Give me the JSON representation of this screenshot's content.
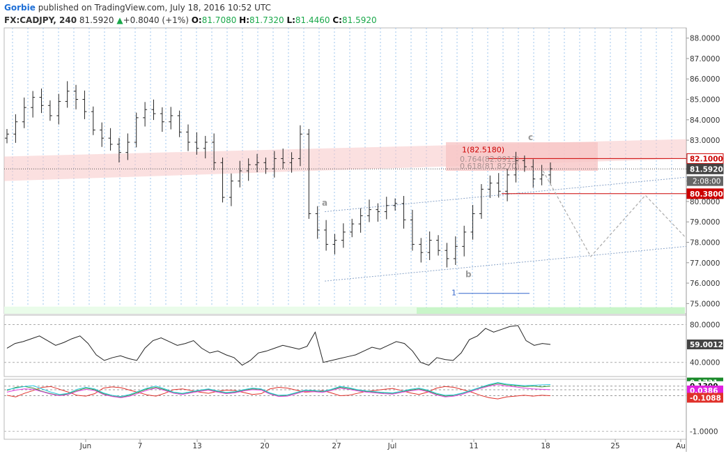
{
  "header": {
    "author": "Gorbie",
    "published_text": "published on TradingView.com, July 18, 2016 10:52 UTC"
  },
  "symbol": {
    "ticker": "FX:CADJPY, 240",
    "last": "81.5920",
    "change": "+0.8040 (+1%)",
    "open_label": "O:",
    "open": "81.7080",
    "high_label": "H:",
    "high": "81.7320",
    "low_label": "L:",
    "low": "81.4460",
    "close_label": "C:",
    "close": "81.5920"
  },
  "colors": {
    "up": "#1aa84a",
    "price_line": "#222222",
    "resistance_zone": "#f7c6c6",
    "support_zone": "#c9f5c9",
    "level_red": "#cc0000",
    "fib_blue": "#3366cc",
    "gridline_blue": "#9ec5ee",
    "oscillator_red": "#e0302a",
    "oscillator_green": "#3a9a3a",
    "oscillator_cyan": "#29c6e0",
    "oscillator_magenta": "#e040e0"
  },
  "chart_data": [
    {
      "type": "candlestick",
      "title": "",
      "x_tick_labels": [
        "Jun",
        "7",
        "13",
        "20",
        "27",
        "Jul",
        "11",
        "18",
        "25",
        "Au"
      ],
      "ylim": [
        74.5,
        88.5
      ],
      "y_tick_labels": [
        "88.0000",
        "87.0000",
        "86.0000",
        "85.0000",
        "84.0000",
        "83.0000",
        "82.0000",
        "81.0000",
        "80.0000",
        "79.0000",
        "78.0000",
        "77.0000",
        "76.0000",
        "75.0000"
      ],
      "y_ticks": [
        88,
        87,
        86,
        85,
        84,
        83,
        82,
        81,
        80,
        79,
        78,
        77,
        76,
        75
      ],
      "closes": [
        83.3,
        83.9,
        84.6,
        85.1,
        84.7,
        84.2,
        84.9,
        85.4,
        85.0,
        84.4,
        83.5,
        83.1,
        82.8,
        82.4,
        82.9,
        84.1,
        84.5,
        84.3,
        83.9,
        84.2,
        83.4,
        82.9,
        82.6,
        82.9,
        81.9,
        80.2,
        81.0,
        81.5,
        81.8,
        81.9,
        81.6,
        82.1,
        81.9,
        82.1,
        83.3,
        79.4,
        78.6,
        77.9,
        78.1,
        78.5,
        78.9,
        79.3,
        79.6,
        79.5,
        79.8,
        79.9,
        79.1,
        77.9,
        77.5,
        78.1,
        77.6,
        77.2,
        77.8,
        78.5,
        79.4,
        80.6,
        80.9,
        80.5,
        81.3,
        82.0,
        81.7,
        81.1,
        81.3,
        81.6
      ],
      "wick_high": 82.5,
      "wick_low": 76.2,
      "current_price": 81.592,
      "price_labels": [
        "82.1000",
        "81.5920",
        "80.3800"
      ],
      "countdown_label": "2:08:00",
      "wave_labels": [
        "a",
        "b",
        "c"
      ],
      "fib_labels": [
        "1(82.5180)",
        "0.764(82.0913)",
        "0.618(81.8270)",
        "1"
      ],
      "levels": {
        "red_upper": 82.1,
        "red_lower": 80.38,
        "resistance_channel": [
          [
            0.0,
            81.8
          ],
          [
            0.92,
            82.6
          ]
        ],
        "fib_zone": [
          81.5,
          82.9
        ],
        "support_zone_low": [
          74.5,
          74.85
        ],
        "rising_channel_low": [
          [
            0.47,
            76.1
          ],
          [
            1.0,
            77.8
          ]
        ],
        "rising_channel_high": [
          [
            0.47,
            79.5
          ],
          [
            0.8,
            80.8
          ]
        ],
        "projection": [
          [
            0.79,
            81.5
          ],
          [
            0.86,
            77.3
          ],
          [
            0.94,
            80.3
          ],
          [
            1.0,
            78.2
          ]
        ],
        "blue_level": 75.5
      }
    },
    {
      "type": "line",
      "title": "",
      "ylim": [
        25,
        90
      ],
      "y_tick_labels": [
        "80.0000",
        "40.0000"
      ],
      "y_ticks": [
        80,
        40
      ],
      "current_label": "59.0012",
      "values": [
        55,
        60,
        62,
        65,
        68,
        63,
        58,
        61,
        65,
        68,
        60,
        48,
        42,
        45,
        47,
        44,
        42,
        55,
        63,
        66,
        62,
        58,
        60,
        63,
        55,
        50,
        52,
        48,
        45,
        37,
        42,
        50,
        52,
        55,
        58,
        56,
        54,
        57,
        72,
        40,
        42,
        44,
        46,
        48,
        52,
        56,
        54,
        58,
        62,
        60,
        52,
        40,
        37,
        45,
        43,
        42,
        50,
        64,
        68,
        76,
        72,
        75,
        78,
        79,
        63,
        58,
        60,
        59
      ]
    },
    {
      "type": "line",
      "title": "",
      "ylim": [
        -1.2,
        0.3
      ],
      "y_tick_labels": [
        "0.1731",
        "0.1300",
        "0.0386",
        "-0.1088",
        "-1.0000"
      ],
      "series": [
        {
          "color": "#e0302a",
          "values": [
            -0.1,
            -0.14,
            -0.05,
            0.02,
            0.1,
            0.12,
            0.05,
            -0.02,
            -0.1,
            -0.12,
            -0.06,
            0.08,
            0.11,
            0.09,
            0.03,
            -0.03,
            -0.09,
            -0.12,
            -0.05,
            0.04,
            0.06,
            0.02,
            -0.02,
            -0.05,
            0.0,
            0.03,
            0.02,
            -0.03,
            -0.08,
            -0.06,
            0.06,
            0.1,
            0.08,
            0.03,
            -0.02,
            -0.01,
            0.02,
            -0.04,
            -0.11,
            -0.1,
            -0.05,
            0.0,
            0.02,
            0.05,
            0.07,
            0.02,
            -0.04,
            -0.08,
            -0.02,
            0.08,
            0.12,
            0.1,
            0.04,
            -0.02,
            -0.1,
            -0.16,
            -0.19,
            -0.14,
            -0.12,
            -0.1,
            -0.12,
            -0.1,
            -0.11
          ]
        },
        {
          "color": "#3a9a3a",
          "values": [
            0.02,
            0.1,
            0.12,
            0.08,
            0.0,
            -0.06,
            -0.1,
            -0.06,
            0.02,
            0.08,
            0.04,
            -0.06,
            -0.12,
            -0.15,
            -0.1,
            -0.02,
            0.06,
            0.1,
            0.04,
            -0.03,
            -0.06,
            -0.02,
            0.02,
            0.05,
            0.0,
            -0.04,
            -0.02,
            0.03,
            0.06,
            0.05,
            -0.05,
            -0.12,
            -0.1,
            -0.04,
            0.02,
            0.01,
            -0.01,
            0.04,
            0.1,
            0.07,
            0.03,
            0.0,
            -0.02,
            -0.04,
            -0.05,
            -0.01,
            0.03,
            0.06,
            0.01,
            -0.07,
            -0.12,
            -0.1,
            -0.05,
            0.02,
            0.09,
            0.15,
            0.2,
            0.16,
            0.14,
            0.12,
            0.13,
            0.11,
            0.13
          ]
        },
        {
          "color": "#29c6e0",
          "values": [
            0.04,
            0.08,
            0.12,
            0.14,
            0.06,
            -0.02,
            -0.08,
            -0.05,
            0.05,
            0.1,
            0.06,
            -0.04,
            -0.1,
            -0.13,
            -0.08,
            0.0,
            0.08,
            0.13,
            0.06,
            -0.02,
            -0.05,
            -0.01,
            0.03,
            0.06,
            0.01,
            -0.03,
            -0.01,
            0.04,
            0.08,
            0.06,
            -0.04,
            -0.1,
            -0.09,
            -0.03,
            0.03,
            0.02,
            0.0,
            0.05,
            0.12,
            0.09,
            0.04,
            0.01,
            -0.01,
            -0.03,
            -0.04,
            0.0,
            0.05,
            0.08,
            0.03,
            -0.05,
            -0.1,
            -0.09,
            -0.04,
            0.03,
            0.1,
            0.17,
            0.22,
            0.18,
            0.16,
            0.14,
            0.15,
            0.16,
            0.17
          ]
        },
        {
          "color": "#e040e0",
          "values": [
            -0.02,
            0.03,
            0.06,
            0.05,
            -0.01,
            -0.07,
            -0.11,
            -0.08,
            0.0,
            0.05,
            0.02,
            -0.08,
            -0.13,
            -0.16,
            -0.12,
            -0.05,
            0.03,
            0.08,
            0.02,
            -0.05,
            -0.08,
            -0.04,
            0.0,
            0.03,
            -0.02,
            -0.06,
            -0.04,
            0.01,
            0.04,
            0.03,
            -0.07,
            -0.13,
            -0.12,
            -0.06,
            0.0,
            -0.01,
            -0.03,
            0.02,
            0.08,
            0.05,
            0.01,
            -0.02,
            -0.04,
            -0.06,
            -0.07,
            -0.03,
            0.01,
            0.04,
            -0.01,
            -0.09,
            -0.14,
            -0.12,
            -0.07,
            0.0,
            0.07,
            0.13,
            0.17,
            0.13,
            0.11,
            0.08,
            0.06,
            0.05,
            0.04
          ]
        }
      ],
      "guide_levels": [
        0.13,
        0.0386,
        -0.1088
      ]
    }
  ]
}
